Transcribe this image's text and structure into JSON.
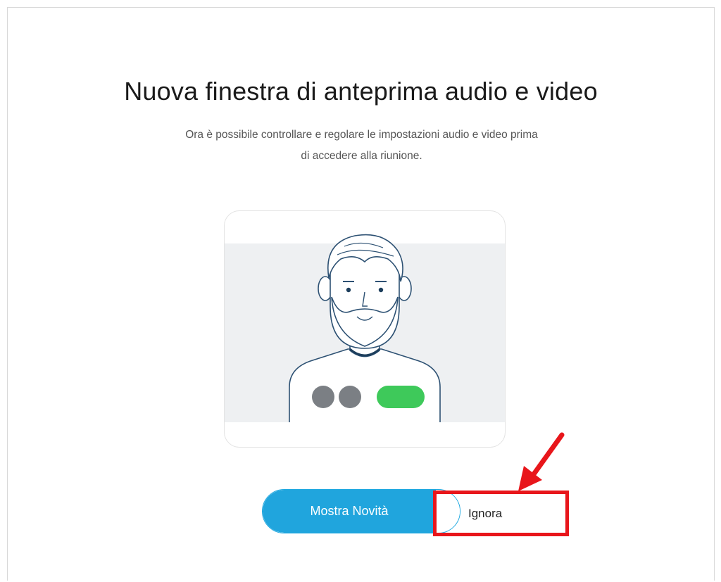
{
  "dialog": {
    "title": "Nuova finestra di anteprima audio e video",
    "subtitle": "Ora è possibile controllare e regolare le impostazioni audio e video prima di accedere alla riunione."
  },
  "buttons": {
    "primary_label": "Mostra Novità",
    "ignore_label": "Ignora"
  },
  "illustration": {
    "icon": "person-preview-illustration",
    "controls": [
      "mic-toggle-icon",
      "camera-toggle-icon",
      "join-pill-icon"
    ]
  },
  "annotation": {
    "arrow_icon": "red-arrow-icon",
    "highlight_color": "#e8161b"
  },
  "colors": {
    "primary": "#20a5dd",
    "join_green": "#3ec95a",
    "control_gray": "#7b7f84",
    "line": "#2d5173"
  }
}
